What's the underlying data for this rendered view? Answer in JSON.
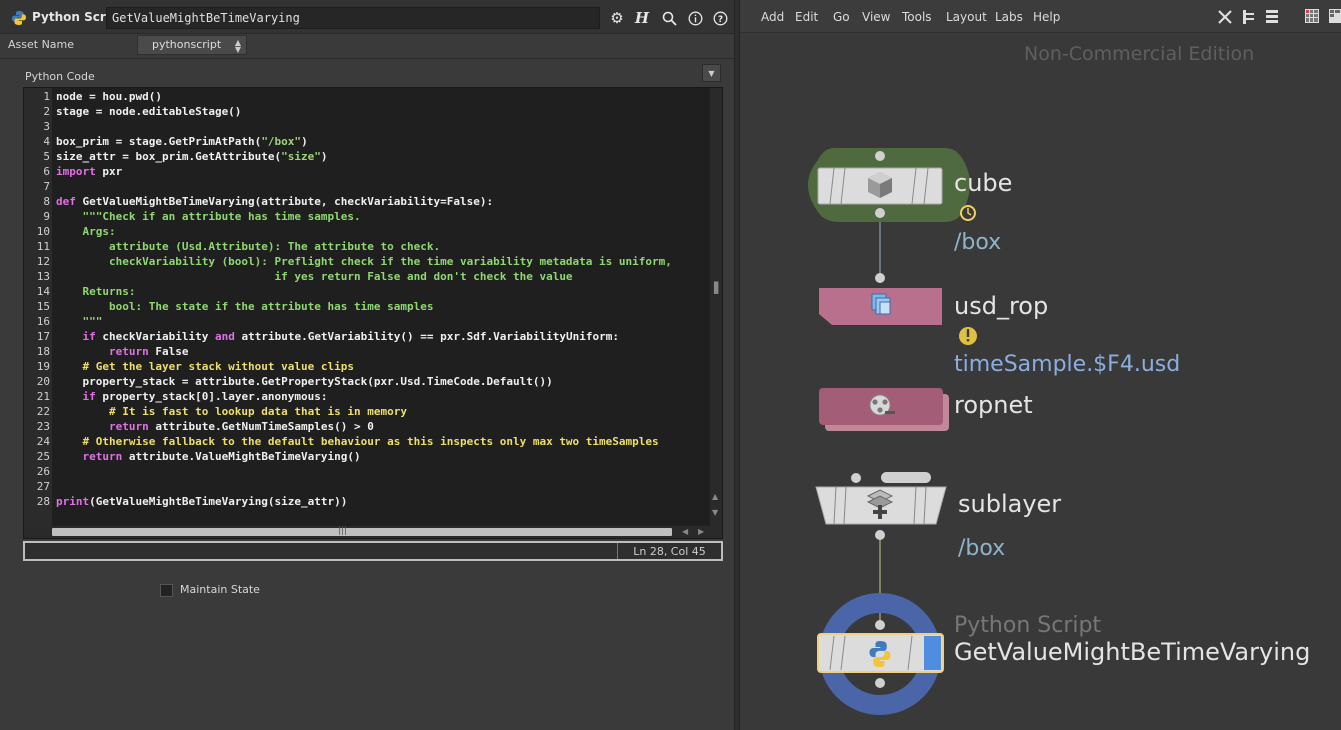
{
  "parameter_pane": {
    "node_type": "Python Script",
    "node_name": "GetValueMightBeTimeVarying",
    "asset_name_label": "Asset Name",
    "asset_name_value": "pythonscript",
    "code_label": "Python Code",
    "status_position": "Ln 28, Col 45",
    "maintain_state_label": "Maintain State",
    "toolbar_icons": [
      "gear-icon",
      "houdini-help-icon",
      "search-icon",
      "info-icon",
      "help-icon"
    ],
    "code_lines": [
      "node = hou.pwd()",
      "stage = node.editableStage()",
      "",
      "box_prim = stage.GetPrimAtPath(\"/box\")",
      "size_attr = box_prim.GetAttribute(\"size\")",
      "import pxr",
      "",
      "def GetValueMightBeTimeVarying(attribute, checkVariability=False):",
      "    \"\"\"Check if an attribute has time samples.",
      "    Args:",
      "        attribute (Usd.Attribute): The attribute to check.",
      "        checkVariability (bool): Preflight check if the time variability metadata is uniform,",
      "                                 if yes return False and don't check the value",
      "    Returns:",
      "        bool: The state if the attribute has time samples",
      "    \"\"\"",
      "    if checkVariability and attribute.GetVariability() == pxr.Sdf.VariabilityUniform:",
      "        return False",
      "    # Get the layer stack without value clips",
      "    property_stack = attribute.GetPropertyStack(pxr.Usd.TimeCode.Default())",
      "    if property_stack[0].layer.anonymous:",
      "        # It is fast to lookup data that is in memory",
      "        return attribute.GetNumTimeSamples() > 0",
      "    # Otherwise fallback to the default behaviour as this inspects only max two timeSamples",
      "    return attribute.ValueMightBeTimeVarying()",
      "",
      "",
      "print(GetValueMightBeTimeVarying(size_attr))"
    ]
  },
  "network_editor": {
    "menu": [
      "Add",
      "Edit",
      "Go",
      "View",
      "Tools",
      "Layout",
      "Labs",
      "Help"
    ],
    "edition_label": "Non-Commercial Edition",
    "nodes": [
      {
        "name": "cube",
        "sub": "/box",
        "icon": "cube-icon",
        "badge": "time-dependent-icon"
      },
      {
        "name": "usd_rop",
        "sub": "timeSample.$F4.usd",
        "icon": "usd-rop-icon",
        "badge": "warning-icon"
      },
      {
        "name": "ropnet",
        "sub": "",
        "icon": "film-reel-icon"
      },
      {
        "name": "sublayer",
        "sub": "/box",
        "icon": "sublayer-icon"
      },
      {
        "name": "GetValueMightBeTimeVarying",
        "type_label": "Python Script",
        "icon": "python-icon"
      }
    ],
    "colors": {
      "cube_bg": "#4f6a3f",
      "usd_rop": "#b8708c",
      "ropnet": "#a35d77",
      "selected_ring": "#4a66a8",
      "selected_outline": "#f0d080",
      "display_flag": "#4f8de0"
    }
  }
}
